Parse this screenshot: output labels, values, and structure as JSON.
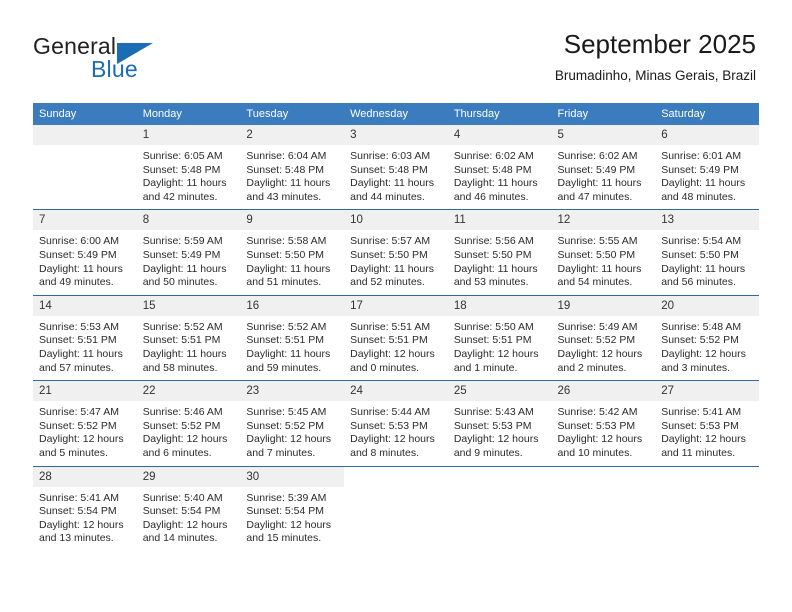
{
  "brand": {
    "name_part1": "General",
    "name_part2": "Blue",
    "accent_color": "#1b6cb5"
  },
  "header": {
    "month_title": "September 2025",
    "location": "Brumadinho, Minas Gerais, Brazil"
  },
  "calendar": {
    "header_bg": "#3a7cbe",
    "row_divider_color": "#2a6aad",
    "daynum_bg": "#f0f0f0",
    "weekday_headers": [
      "Sunday",
      "Monday",
      "Tuesday",
      "Wednesday",
      "Thursday",
      "Friday",
      "Saturday"
    ],
    "weeks": [
      [
        {
          "day": "",
          "lines": []
        },
        {
          "day": "1",
          "lines": [
            "Sunrise: 6:05 AM",
            "Sunset: 5:48 PM",
            "Daylight: 11 hours",
            "and 42 minutes."
          ]
        },
        {
          "day": "2",
          "lines": [
            "Sunrise: 6:04 AM",
            "Sunset: 5:48 PM",
            "Daylight: 11 hours",
            "and 43 minutes."
          ]
        },
        {
          "day": "3",
          "lines": [
            "Sunrise: 6:03 AM",
            "Sunset: 5:48 PM",
            "Daylight: 11 hours",
            "and 44 minutes."
          ]
        },
        {
          "day": "4",
          "lines": [
            "Sunrise: 6:02 AM",
            "Sunset: 5:48 PM",
            "Daylight: 11 hours",
            "and 46 minutes."
          ]
        },
        {
          "day": "5",
          "lines": [
            "Sunrise: 6:02 AM",
            "Sunset: 5:49 PM",
            "Daylight: 11 hours",
            "and 47 minutes."
          ]
        },
        {
          "day": "6",
          "lines": [
            "Sunrise: 6:01 AM",
            "Sunset: 5:49 PM",
            "Daylight: 11 hours",
            "and 48 minutes."
          ]
        }
      ],
      [
        {
          "day": "7",
          "lines": [
            "Sunrise: 6:00 AM",
            "Sunset: 5:49 PM",
            "Daylight: 11 hours",
            "and 49 minutes."
          ]
        },
        {
          "day": "8",
          "lines": [
            "Sunrise: 5:59 AM",
            "Sunset: 5:49 PM",
            "Daylight: 11 hours",
            "and 50 minutes."
          ]
        },
        {
          "day": "9",
          "lines": [
            "Sunrise: 5:58 AM",
            "Sunset: 5:50 PM",
            "Daylight: 11 hours",
            "and 51 minutes."
          ]
        },
        {
          "day": "10",
          "lines": [
            "Sunrise: 5:57 AM",
            "Sunset: 5:50 PM",
            "Daylight: 11 hours",
            "and 52 minutes."
          ]
        },
        {
          "day": "11",
          "lines": [
            "Sunrise: 5:56 AM",
            "Sunset: 5:50 PM",
            "Daylight: 11 hours",
            "and 53 minutes."
          ]
        },
        {
          "day": "12",
          "lines": [
            "Sunrise: 5:55 AM",
            "Sunset: 5:50 PM",
            "Daylight: 11 hours",
            "and 54 minutes."
          ]
        },
        {
          "day": "13",
          "lines": [
            "Sunrise: 5:54 AM",
            "Sunset: 5:50 PM",
            "Daylight: 11 hours",
            "and 56 minutes."
          ]
        }
      ],
      [
        {
          "day": "14",
          "lines": [
            "Sunrise: 5:53 AM",
            "Sunset: 5:51 PM",
            "Daylight: 11 hours",
            "and 57 minutes."
          ]
        },
        {
          "day": "15",
          "lines": [
            "Sunrise: 5:52 AM",
            "Sunset: 5:51 PM",
            "Daylight: 11 hours",
            "and 58 minutes."
          ]
        },
        {
          "day": "16",
          "lines": [
            "Sunrise: 5:52 AM",
            "Sunset: 5:51 PM",
            "Daylight: 11 hours",
            "and 59 minutes."
          ]
        },
        {
          "day": "17",
          "lines": [
            "Sunrise: 5:51 AM",
            "Sunset: 5:51 PM",
            "Daylight: 12 hours",
            "and 0 minutes."
          ]
        },
        {
          "day": "18",
          "lines": [
            "Sunrise: 5:50 AM",
            "Sunset: 5:51 PM",
            "Daylight: 12 hours",
            "and 1 minute."
          ]
        },
        {
          "day": "19",
          "lines": [
            "Sunrise: 5:49 AM",
            "Sunset: 5:52 PM",
            "Daylight: 12 hours",
            "and 2 minutes."
          ]
        },
        {
          "day": "20",
          "lines": [
            "Sunrise: 5:48 AM",
            "Sunset: 5:52 PM",
            "Daylight: 12 hours",
            "and 3 minutes."
          ]
        }
      ],
      [
        {
          "day": "21",
          "lines": [
            "Sunrise: 5:47 AM",
            "Sunset: 5:52 PM",
            "Daylight: 12 hours",
            "and 5 minutes."
          ]
        },
        {
          "day": "22",
          "lines": [
            "Sunrise: 5:46 AM",
            "Sunset: 5:52 PM",
            "Daylight: 12 hours",
            "and 6 minutes."
          ]
        },
        {
          "day": "23",
          "lines": [
            "Sunrise: 5:45 AM",
            "Sunset: 5:52 PM",
            "Daylight: 12 hours",
            "and 7 minutes."
          ]
        },
        {
          "day": "24",
          "lines": [
            "Sunrise: 5:44 AM",
            "Sunset: 5:53 PM",
            "Daylight: 12 hours",
            "and 8 minutes."
          ]
        },
        {
          "day": "25",
          "lines": [
            "Sunrise: 5:43 AM",
            "Sunset: 5:53 PM",
            "Daylight: 12 hours",
            "and 9 minutes."
          ]
        },
        {
          "day": "26",
          "lines": [
            "Sunrise: 5:42 AM",
            "Sunset: 5:53 PM",
            "Daylight: 12 hours",
            "and 10 minutes."
          ]
        },
        {
          "day": "27",
          "lines": [
            "Sunrise: 5:41 AM",
            "Sunset: 5:53 PM",
            "Daylight: 12 hours",
            "and 11 minutes."
          ]
        }
      ],
      [
        {
          "day": "28",
          "lines": [
            "Sunrise: 5:41 AM",
            "Sunset: 5:54 PM",
            "Daylight: 12 hours",
            "and 13 minutes."
          ]
        },
        {
          "day": "29",
          "lines": [
            "Sunrise: 5:40 AM",
            "Sunset: 5:54 PM",
            "Daylight: 12 hours",
            "and 14 minutes."
          ]
        },
        {
          "day": "30",
          "lines": [
            "Sunrise: 5:39 AM",
            "Sunset: 5:54 PM",
            "Daylight: 12 hours",
            "and 15 minutes."
          ]
        },
        {
          "day": "",
          "lines": []
        },
        {
          "day": "",
          "lines": []
        },
        {
          "day": "",
          "lines": []
        },
        {
          "day": "",
          "lines": []
        }
      ]
    ]
  }
}
